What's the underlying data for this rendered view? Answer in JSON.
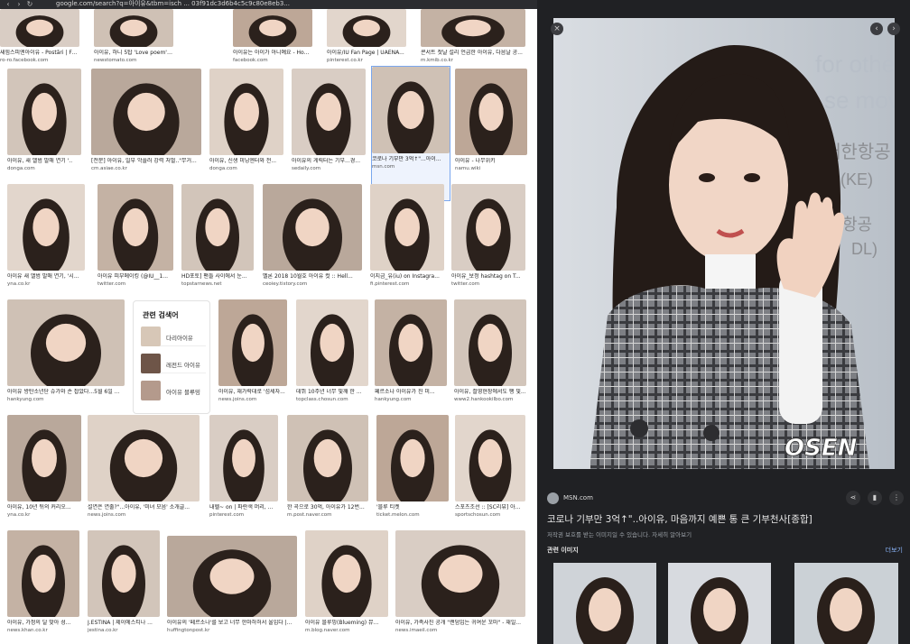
{
  "browser": {
    "url": "google.com/search?q=아이유&tbm=isch ... 03f91dc3d6b4c5c9c80e8eb3..."
  },
  "results": [
    {
      "caption": "새힘스피엔아이유 - Postări | Facebook",
      "source": "ro-ro.facebook.com"
    },
    {
      "caption": "아이유, 하니 5탑 'Love poem'이주...",
      "source": "newstomato.com"
    },
    {
      "caption": "아이유는 아이가 아니예요 - Ho...",
      "source": "facebook.com"
    },
    {
      "caption": "아이유/IU Fan Page | UAENA...",
      "source": "pinterest.co.kr"
    },
    {
      "caption": "콘서트 첫날 설리 언급한 아이유, 다음날 공...",
      "source": "m.kmib.co.kr"
    },
    {
      "caption": "아이유, 새 앨범 발매 연기 '..",
      "source": "donga.com"
    },
    {
      "caption": "[전문] 아이유, 일부 악플러 강력 처벌..\"무거...",
      "source": "cm.asiae.co.kr"
    },
    {
      "caption": "아이유, 신생 미닝엔터와 전...",
      "source": "donga.com"
    },
    {
      "caption": "아이유의 게릭터는 기부...경...",
      "source": "sedaily.com"
    },
    {
      "caption": "코로나 기부만 3억↑\"...아이...",
      "source": "msn.com"
    },
    {
      "caption": "아이유 - 나무위키",
      "source": "namu.wiki"
    },
    {
      "caption": "아이유 새 앨범 발매 연기, '시...",
      "source": "yna.co.kr"
    },
    {
      "caption": "아이유 피부메이킹 (@IU__1...",
      "source": "twitter.com"
    },
    {
      "caption": "HD포토] 팬들 사이에서 눈...",
      "source": "topstarnews.net"
    },
    {
      "caption": "멜론 2018 10월호 아이유 컷 :: Hell...",
      "source": "ceoiey.tistory.com"
    },
    {
      "caption": "이지금_유(iu) on Instagra...",
      "source": "fi.pinterest.com"
    },
    {
      "caption": "아이유_보정 hashtag on T...",
      "source": "twitter.com"
    },
    {
      "caption": "아이유 방탄소년단 슈가와 손 잡았다...5월 6일 ...",
      "source": "hankyung.com"
    },
    {
      "caption": "아이유, 재가락대로 '섬세자...",
      "source": "news.joins.com"
    },
    {
      "caption": "데뷔 10주년 너무 빛깨 한 ...",
      "source": "topclass.chosun.com"
    },
    {
      "caption": "페르소나 아이유가 진 미...",
      "source": "hankyung.com"
    },
    {
      "caption": "아이유, 촬영현장에서도 팽 빛...",
      "source": "www2.hankookilbo.com"
    },
    {
      "caption": "아이유, 10년 뒤의 커리오...",
      "source": "yna.co.kr"
    },
    {
      "caption": "설연은 연출?\"...아이유, '미녀 모음' 소개글...",
      "source": "news.joins.com"
    },
    {
      "caption": "내헬~ on | 파란색 머리, ...",
      "source": "pinterest.com"
    },
    {
      "caption": "한 곡으로 30억, 아이유가 12번...",
      "source": "m.post.naver.com"
    },
    {
      "caption": "'블루 티켓",
      "source": "ticket.melon.com"
    },
    {
      "caption": "스포츠조선 :: [SC리뷰] 아이유가...",
      "source": "sportschosun.com"
    },
    {
      "caption": "아이유, 가정의 달 맞아 성...",
      "source": "news.khan.co.kr"
    },
    {
      "caption": "J.ESTINA | 제이에스티나 ...",
      "source": "jestina.co.kr"
    },
    {
      "caption": "아이유의 '페르소나'를 보고 너무 한마하허서 올입다 |...",
      "source": "huffingtonpost.kr"
    },
    {
      "caption": "아이유 블루밍(Blueming) 뮤...",
      "source": "m.blog.naver.com"
    },
    {
      "caption": "아이유, 가족사진 공개 \"랜덤입는 귀여운 꼬마\" - 재일...",
      "source": "news.imaeil.com"
    }
  ],
  "related_searches": {
    "title": "관련 검색어",
    "items": [
      "다리아이유",
      "레전드 아이유",
      "아이유 블루밍"
    ]
  },
  "preview": {
    "watermark": "OSEN",
    "site_name": "MSN.com",
    "title": "코로나 기부만 3억↑\"..아이유, 마음까지 예쁜 통 큰 기부천사[종합]",
    "note": "저작권 보호를 받는 이미지일 수 있습니다.  자세히 알아보기",
    "related_heading": "관련 이미지",
    "more_label": "더보기",
    "sign_text": "for other a / se mov / 대한항공 / (KE) / 항공 / DL)"
  },
  "colors": {
    "panel_bg": "#202124",
    "link": "#8ab4f8",
    "selected_outline": "#7aa7ee"
  },
  "icons": [
    "close-icon",
    "prev-arrow-icon",
    "next-arrow-icon",
    "share-icon",
    "bookmark-icon",
    "more-vert-icon"
  ]
}
